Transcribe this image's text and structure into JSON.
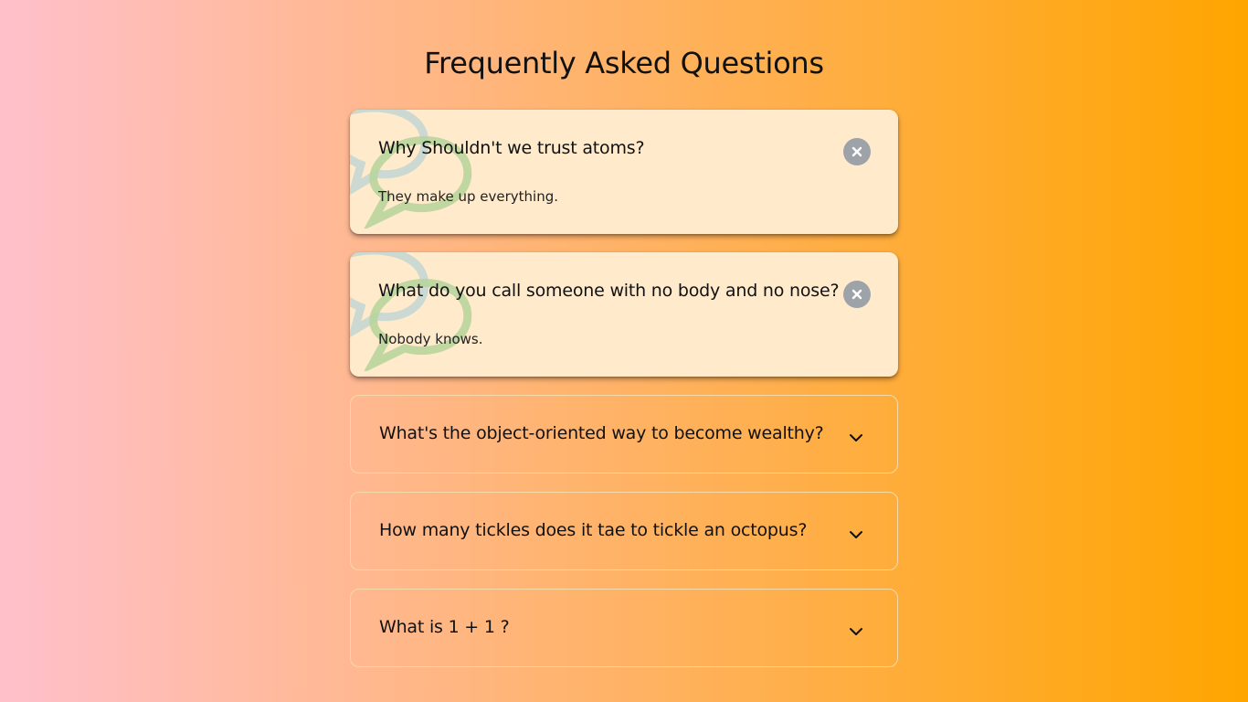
{
  "page": {
    "title": "Frequently Asked Questions"
  },
  "colors": {
    "gradient_start": "#ffc0cb",
    "gradient_end": "#ffa500",
    "open_card_bg": "#ffebcb",
    "close_button": "#9ea3aa"
  },
  "faqs": [
    {
      "question": "Why Shouldn't we trust atoms?",
      "answer": "They make up everything.",
      "state": "open",
      "toggle_icon": "close-icon"
    },
    {
      "question": "What do you call someone with no body and no nose?",
      "answer": "Nobody knows.",
      "state": "open",
      "toggle_icon": "close-icon"
    },
    {
      "question": "What's the object-oriented way to become wealthy?",
      "state": "closed",
      "toggle_icon": "chevron-down-icon"
    },
    {
      "question": "How many tickles does it tae to tickle an octopus?",
      "state": "closed",
      "toggle_icon": "chevron-down-icon"
    },
    {
      "question": "What is 1 + 1 ?",
      "state": "closed",
      "toggle_icon": "chevron-down-icon"
    }
  ]
}
